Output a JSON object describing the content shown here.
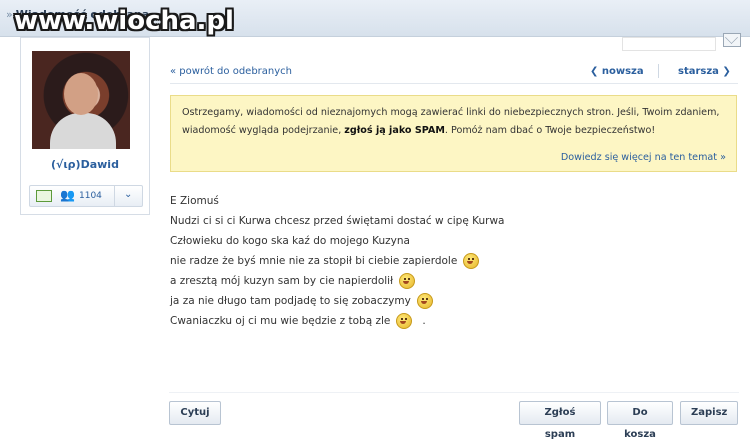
{
  "header": {
    "tab_label": "Wiadomość odebrana",
    "tab_arrows": "»",
    "watermark": "www.wiocha.pl"
  },
  "sidebar": {
    "username": "(√ιρ)Dawid",
    "count": "1104",
    "icons": [
      "message-icon",
      "people-icon",
      "chevron-down-icon"
    ]
  },
  "nav": {
    "back": "« powrót do odebranych",
    "newer": "❮  nowsza",
    "older": "starsza  ❯"
  },
  "warning": {
    "line1": "Ostrzegamy, wiadomości od nieznajomych mogą zawierać linki do niebezpiecznych stron. Jeśli, Twoim zdaniem,",
    "line2_pre": "wiadomość wygląda podejrzanie, ",
    "line2_bold": "zgłoś ją jako SPAM",
    "line2_post": ". Pomóż nam dbać o Twoje bezpieczeństwo!",
    "more": "Dowiedz się więcej na ten temat »"
  },
  "message": {
    "lines": [
      "E Ziomuś",
      "Nudzi ci si ci Kurwa chcesz przed świętami dostać w cipę Kurwa",
      "Człowieku do kogo ska kaź do mojego Kuzyna",
      "nie radze że byś mnie nie za stopił bi ciebie zapierdole",
      "a zresztą mój kuzyn sam by cie napierdolił",
      "ja za nie długo tam podjadę to się zobaczymy",
      "Cwaniaczku oj ci mu wie będzie z tobą zle"
    ],
    "trailing": "."
  },
  "buttons": {
    "quote": "Cytuj",
    "spam": "Zgłoś spam",
    "trash": "Do kosza",
    "save": "Zapisz"
  }
}
